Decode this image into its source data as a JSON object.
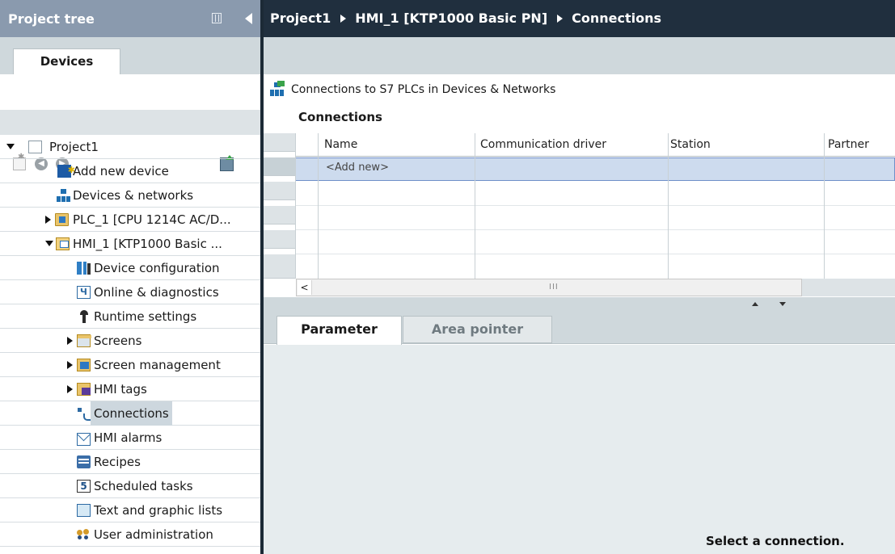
{
  "project_tree": {
    "title": "Project tree",
    "tab": "Devices",
    "items": [
      {
        "label": "Project1",
        "icon": "project-icon"
      },
      {
        "label": "Add new device",
        "icon": "add-device-icon"
      },
      {
        "label": "Devices & networks",
        "icon": "network-icon"
      },
      {
        "label": "PLC_1 [CPU 1214C AC/D...",
        "icon": "plc-folder-icon"
      },
      {
        "label": "HMI_1 [KTP1000 Basic ...",
        "icon": "hmi-folder-icon"
      },
      {
        "label": "Device configuration",
        "icon": "device-config-icon"
      },
      {
        "label": "Online & diagnostics",
        "icon": "online-diagnostics-icon"
      },
      {
        "label": "Runtime settings",
        "icon": "runtime-settings-icon"
      },
      {
        "label": "Screens",
        "icon": "screens-folder-icon"
      },
      {
        "label": "Screen management",
        "icon": "screen-management-icon"
      },
      {
        "label": "HMI tags",
        "icon": "hmi-tags-icon"
      },
      {
        "label": "Connections",
        "icon": "connections-icon"
      },
      {
        "label": "HMI alarms",
        "icon": "alarms-icon"
      },
      {
        "label": "Recipes",
        "icon": "recipes-icon"
      },
      {
        "label": "Scheduled tasks",
        "icon": "scheduled-tasks-icon",
        "glyph": "5"
      },
      {
        "label": "Text and graphic lists",
        "icon": "text-graphic-lists-icon"
      },
      {
        "label": "User administration",
        "icon": "user-admin-icon"
      }
    ],
    "selected": "Connections"
  },
  "breadcrumb": {
    "items": [
      "Project1",
      "HMI_1 [KTP1000 Basic PN]",
      "Connections"
    ]
  },
  "editor": {
    "info_text": "Connections to S7 PLCs in Devices & Networks",
    "section_title": "Connections",
    "columns": [
      "Name",
      "Communication driver",
      "Station",
      "Partner"
    ],
    "add_new": "<Add new>",
    "scroll_grip": "III"
  },
  "inspector": {
    "tabs": [
      "Parameter",
      "Area pointer"
    ],
    "active_tab": "Parameter",
    "message": "Select a connection."
  },
  "colors": {
    "left_header": "#8a9aae",
    "breadcrumb_bg": "#202f3e",
    "panel_bg": "#cfd8dc",
    "selection": "#cddbee"
  }
}
